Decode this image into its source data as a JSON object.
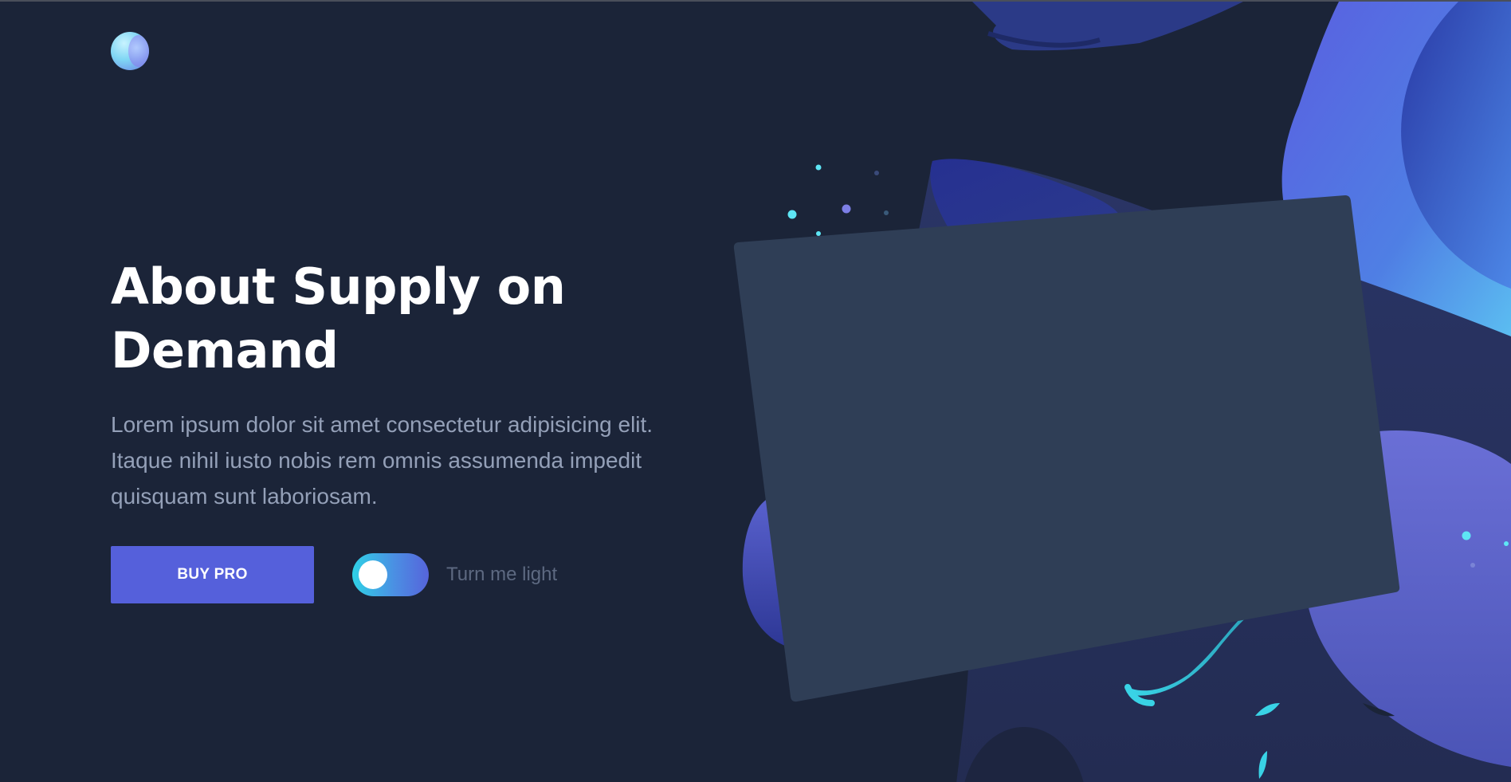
{
  "hero": {
    "title": "About Supply on Demand",
    "text": "Lorem ipsum dolor sit amet consectetur adipisicing elit. Itaque nihil iusto nobis rem omnis assumenda impedit quisquam sunt laboriosam."
  },
  "actions": {
    "buy_label": "BUY PRO",
    "toggle_label": "Turn me light",
    "toggle_on": true
  },
  "colors": {
    "background": "#1b2438",
    "accent": "#5560db",
    "card": "#2f3e56",
    "toggle_gradient_start": "#2fd1e6",
    "text_muted": "#94a0b8"
  },
  "icons": {
    "logo": "gradient-orb-logo"
  }
}
